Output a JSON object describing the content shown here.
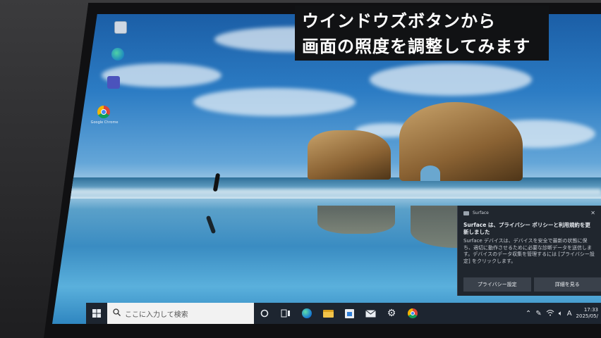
{
  "caption": {
    "line1": "ウインドウズボタンから",
    "line2": "画面の照度を調整してみます"
  },
  "desktop": {
    "icons": [
      {
        "name": "recycle-bin-icon",
        "label": ""
      },
      {
        "name": "edge-icon",
        "label": ""
      },
      {
        "name": "teams-icon",
        "label": ""
      },
      {
        "name": "chrome-icon",
        "label": "Google Chrome"
      }
    ]
  },
  "taskbar": {
    "search_placeholder": "ここに入力して検索",
    "apps": [
      "start-icon",
      "cortana-icon",
      "task-view-icon",
      "edge-icon",
      "file-explorer-icon",
      "store-icon",
      "mail-icon",
      "settings-icon",
      "chrome-icon"
    ],
    "tray": {
      "time": "17:33",
      "date": "2025/05/",
      "ime": "A"
    }
  },
  "toast": {
    "app_name": "Surface",
    "title": "Surface は、プライバシー ポリシーと利用規約を更新しました",
    "body": "Surface デバイスは、デバイスを安全で最新の状態に保ち、適切に動作させるために必要な診断データを送信します。デバイスのデータ収集を管理するには [プライバシー設定] をクリックします。",
    "button_privacy": "プライバシー設定",
    "button_details": "詳細を見る"
  },
  "colors": {
    "taskbar": "#1d2530",
    "toast_bg": "#20262e",
    "caption_bg": "#111214"
  }
}
